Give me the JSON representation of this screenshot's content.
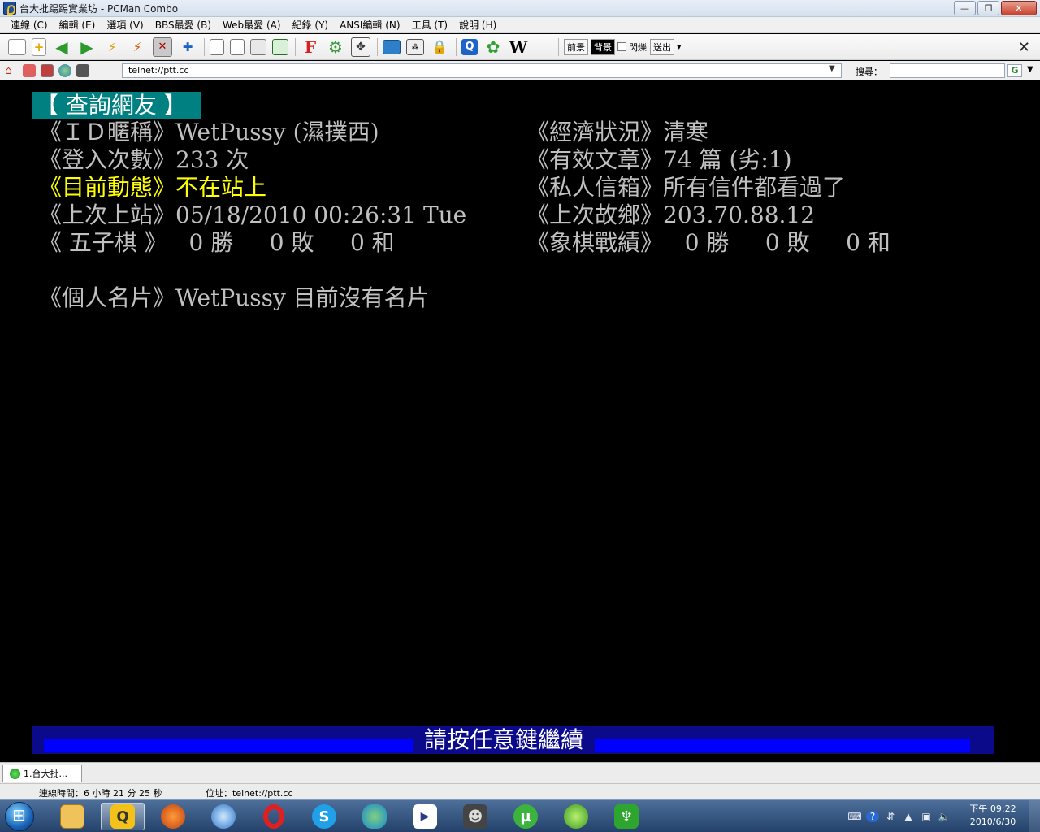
{
  "window": {
    "title": "台大批踢踢實業坊 - PCMan Combo",
    "controls": {
      "minimize": "—",
      "maximize": "❐",
      "close": "✕"
    }
  },
  "menu": {
    "items": [
      "連線 (C)",
      "編輯 (E)",
      "選項 (V)",
      "BBS最愛 (B)",
      "Web最愛 (A)",
      "紀錄 (Y)",
      "ANSI編輯 (N)",
      "工具 (T)",
      "說明 (H)"
    ]
  },
  "toolbar": {
    "foreground_label": "前景",
    "background_label": "背景",
    "blink_label": "閃爍",
    "send_label": "送出",
    "wiki_glyph": "W",
    "font_glyph": "F"
  },
  "addressbar": {
    "url": "telnet://ptt.cc",
    "search_label": "搜尋：",
    "search_value": "",
    "search_engine": "G"
  },
  "terminal": {
    "title": "【 查詢網友 】",
    "left": [
      {
        "label": "《ＩＤ暱稱》",
        "value": "WetPussy (濕撲西)",
        "highlight": false
      },
      {
        "label": "《登入次數》",
        "value": "233 次",
        "highlight": false
      },
      {
        "label": "《目前動態》",
        "value": "不在站上",
        "highlight": true
      },
      {
        "label": "《上次上站》",
        "value": "05/18/2010 00:26:31 Tue",
        "highlight": false
      },
      {
        "label": "《 五子棋 》",
        "value": "   0 勝     0 敗     0 和",
        "highlight": false
      }
    ],
    "right": [
      {
        "label": "《經濟狀況》",
        "value": "清寒"
      },
      {
        "label": "《有效文章》",
        "value": "74 篇 (劣:1)"
      },
      {
        "label": "《私人信箱》",
        "value": "所有信件都看過了"
      },
      {
        "label": "《上次故鄉》",
        "value": "203.70.88.12"
      },
      {
        "label": "《象棋戰績》",
        "value": "   0 勝     0 敗     0 和"
      }
    ],
    "card_label": "《個人名片》",
    "card_value": "WetPussy 目前沒有名片",
    "press_key": "請按任意鍵繼續"
  },
  "tabs": [
    {
      "label": "1.台大批..."
    }
  ],
  "status": {
    "connection_time": "連線時間：6 小時 21 分 25 秒",
    "address": "位址：telnet://ptt.cc"
  },
  "taskbar": {
    "clock_time": "下午 09:22",
    "clock_date": "2010/6/30"
  }
}
